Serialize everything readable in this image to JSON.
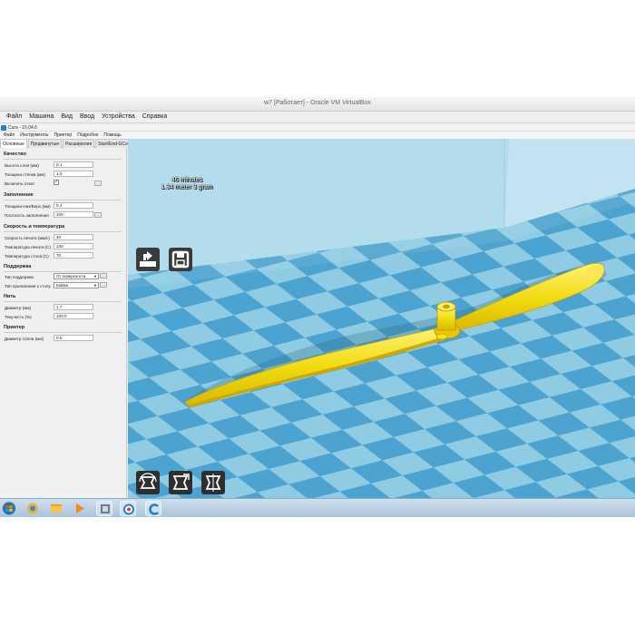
{
  "vbox": {
    "title": "w7 [Работает] - Oracle VM VirtualBox",
    "menu": [
      "Файл",
      "Машина",
      "Вид",
      "Ввод",
      "Устройства",
      "Справка"
    ]
  },
  "cura": {
    "title": "Cura - 15.04.6",
    "menu": [
      "Файл",
      "Инструменты",
      "Принтер",
      "Подробно",
      "Помощь"
    ],
    "tabs": [
      "Основные",
      "Продвинутые",
      "Расширения",
      "Start/End-GCode"
    ]
  },
  "settings": {
    "quality": {
      "title": "Качество",
      "layer_height_label": "Высота слоя (мм)",
      "layer_height": "0.1",
      "shell_thickness_label": "Толщина стенки (мм)",
      "shell_thickness": "1.0",
      "retraction_label": "Включить откат",
      "retraction": "✓",
      "more_label": "..."
    },
    "fill": {
      "title": "Заполнение",
      "bottom_top_label": "Толщина Низ/Верх (мм)",
      "bottom_top": "0.4",
      "density_label": "Плотность заполнения",
      "density": "100",
      "more_label": "..."
    },
    "speed": {
      "title": "Скорость и температура",
      "print_speed_label": "Скорость печати (мм/с)",
      "print_speed": "40",
      "print_temp_label": "Температура печати (C)",
      "print_temp": "230",
      "bed_temp_label": "Температура стола (C)",
      "bed_temp": "70"
    },
    "support": {
      "title": "Поддержка",
      "type_label": "Тип поддержки",
      "type": "От поверхности",
      "adhesion_label": "Тип прилипания к столу",
      "adhesion": "Кайма",
      "more_label": "..."
    },
    "filament": {
      "title": "Нить",
      "diameter_label": "Диаметр (мм)",
      "diameter": "1.7",
      "flow_label": "Текучесть (%)",
      "flow": "100.0"
    },
    "printer": {
      "title": "Принтер",
      "nozzle_label": "Диаметр сопла (мм)",
      "nozzle": "0.5"
    }
  },
  "viewport": {
    "print_time": "46 minutes",
    "print_material": "1.34 meter 3 gram",
    "icons": [
      "load-model-icon",
      "save-gcode-icon",
      "rotate-icon",
      "scale-icon",
      "mirror-icon"
    ],
    "colors": {
      "model": "#f5e21a",
      "floor_light": "#8dcbe3",
      "floor_dark": "#4a9fcc",
      "wall": "#a8d7ea"
    }
  },
  "taskbar": {
    "icons": [
      "start-orb-icon",
      "explorer-icon",
      "folder-icon",
      "media-player-icon",
      "app-icon",
      "cura-task-icon",
      "ccleaner-icon"
    ]
  }
}
